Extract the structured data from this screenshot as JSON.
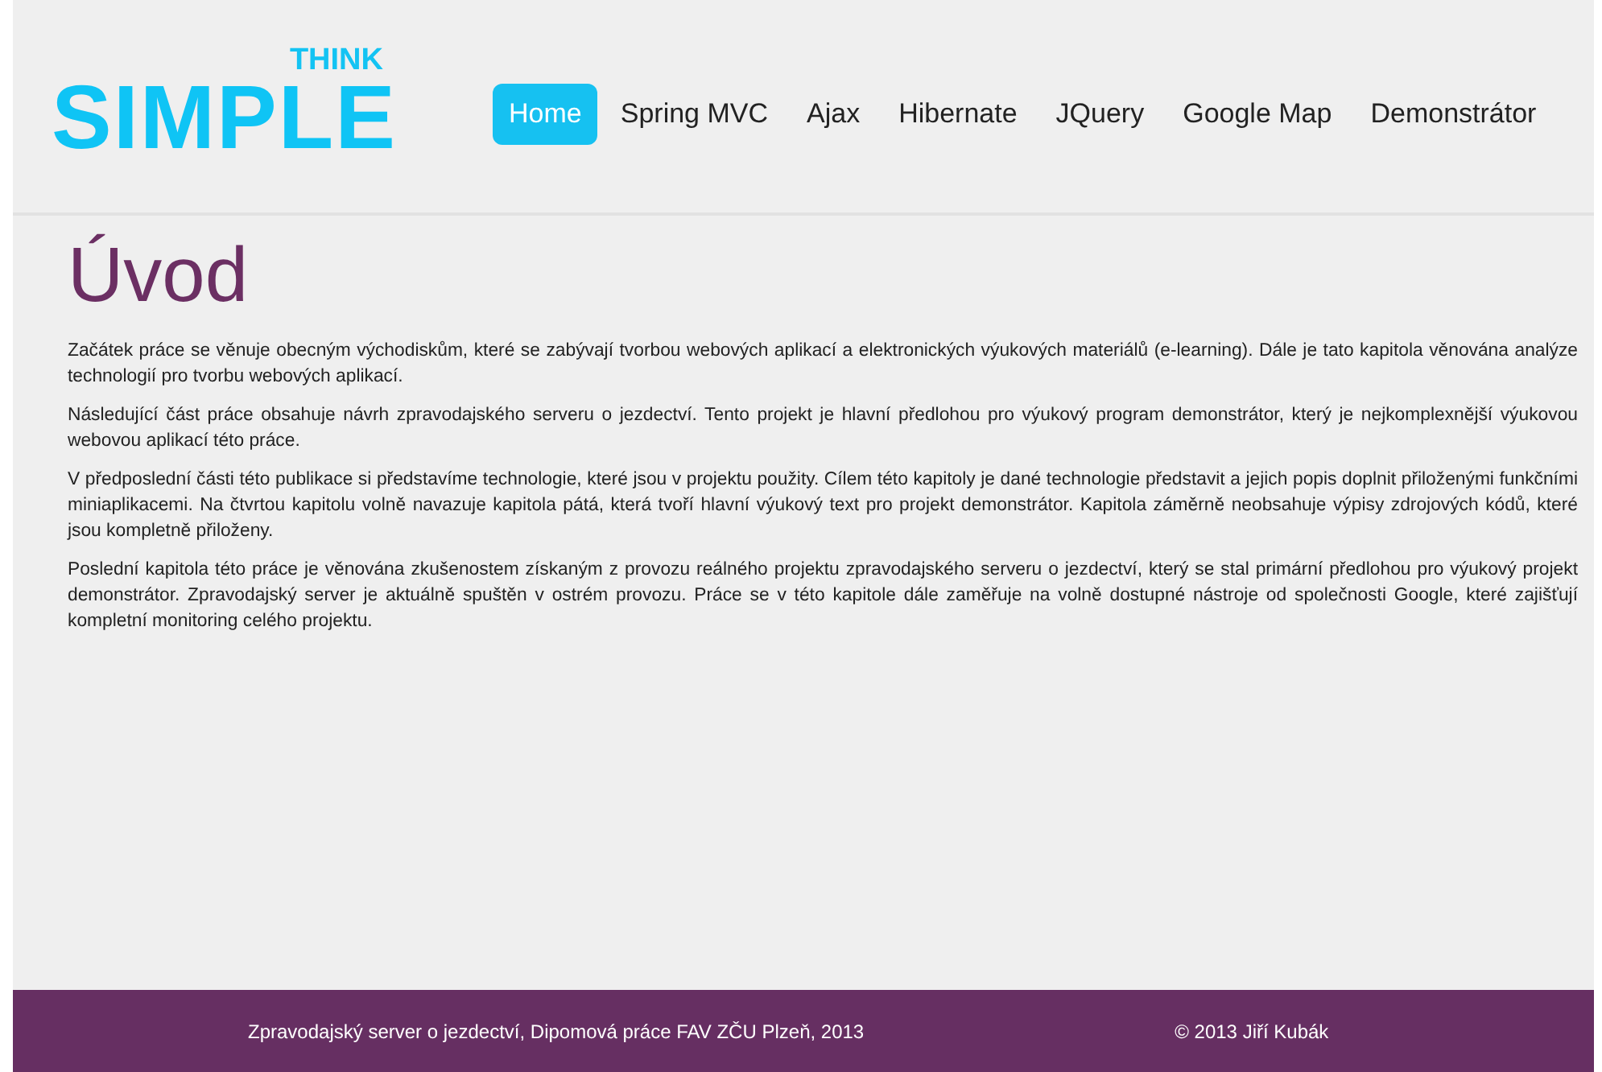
{
  "logo": {
    "small": "THINK",
    "large": "SIMPLE"
  },
  "nav": [
    {
      "label": "Home",
      "selected": true
    },
    {
      "label": "Spring MVC",
      "selected": false
    },
    {
      "label": "Ajax",
      "selected": false
    },
    {
      "label": "Hibernate",
      "selected": false
    },
    {
      "label": "JQuery",
      "selected": false
    },
    {
      "label": "Google Map",
      "selected": false
    },
    {
      "label": "Demonstrátor",
      "selected": false
    }
  ],
  "heading": "Úvod",
  "paragraphs": [
    "Začátek práce se věnuje obecným východiskům, které se zabývají tvorbou webových aplikací a elektronických výukových materiálů (e-learning). Dále je tato kapitola věnována analýze technologií pro tvorbu webových aplikací.",
    "Následující část práce obsahuje návrh zpravodajského serveru o jezdectví. Tento projekt je hlavní předlohou pro výukový program demonstrátor, který je nejkomplexnější výukovou webovou aplikací této práce.",
    "V předposlední části této publikace si představíme technologie, které jsou v projektu použity. Cílem této kapitoly je dané technologie představit a jejich popis doplnit přiloženými funkčními miniaplikacemi. Na čtvrtou kapitolu volně navazuje kapitola pátá, která tvoří hlavní výukový text pro projekt demonstrátor. Kapitola záměrně neobsahuje výpisy zdrojových kódů, které jsou kompletně přiloženy.",
    "Poslední kapitola této práce je věnována zkušenostem získaným z provozu reálného projektu zpravodajského serveru o jezdectví, který se stal primární předlohou pro výukový projekt demonstrátor. Zpravodajský server je aktuálně spuštěn v ostrém provozu. Práce se v této kapitole dále zaměřuje na volně dostupné nástroje od společnosti Google, které zajišťují kompletní monitoring celého projektu."
  ],
  "footer": {
    "left": "Zpravodajský server o jezdectví, Dipomová práce FAV ZČU Plzeň, 2013",
    "right": "© 2013 Jiří Kubák"
  }
}
